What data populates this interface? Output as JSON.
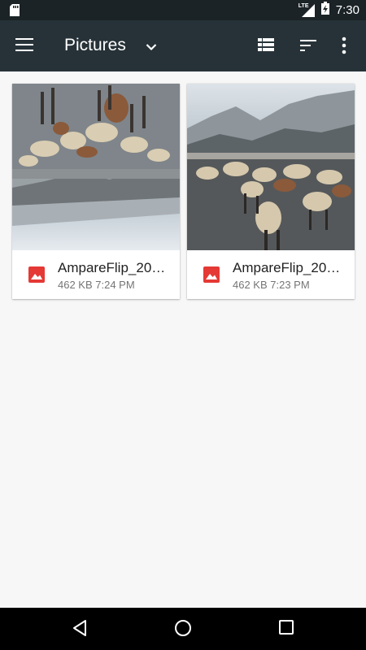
{
  "status_bar": {
    "network": "LTE",
    "time": "7:30",
    "icons": [
      "sd-card-icon",
      "signal-icon",
      "battery-charging-icon"
    ]
  },
  "toolbar": {
    "title": "Pictures",
    "icons": [
      "menu-icon",
      "chevron-down-icon",
      "list-view-icon",
      "sort-icon",
      "more-vert-icon"
    ]
  },
  "files": [
    {
      "name": "AmpareFlip_20…",
      "size": "462 KB",
      "time": "7:24 PM",
      "meta": "462 KB 7:24 PM",
      "icon": "image-file-icon",
      "thumbnail": "goats-mountain-flipped"
    },
    {
      "name": "AmpareFlip_20…",
      "size": "462 KB",
      "time": "7:23 PM",
      "meta": "462 KB 7:23 PM",
      "icon": "image-file-icon",
      "thumbnail": "goats-mountain"
    }
  ],
  "nav_bar": {
    "icons": [
      "back-icon",
      "home-icon",
      "recents-icon"
    ]
  },
  "colors": {
    "status_bar": "#1b2327",
    "toolbar": "#263238",
    "background": "#f7f7f7",
    "file_icon": "#e53935"
  }
}
